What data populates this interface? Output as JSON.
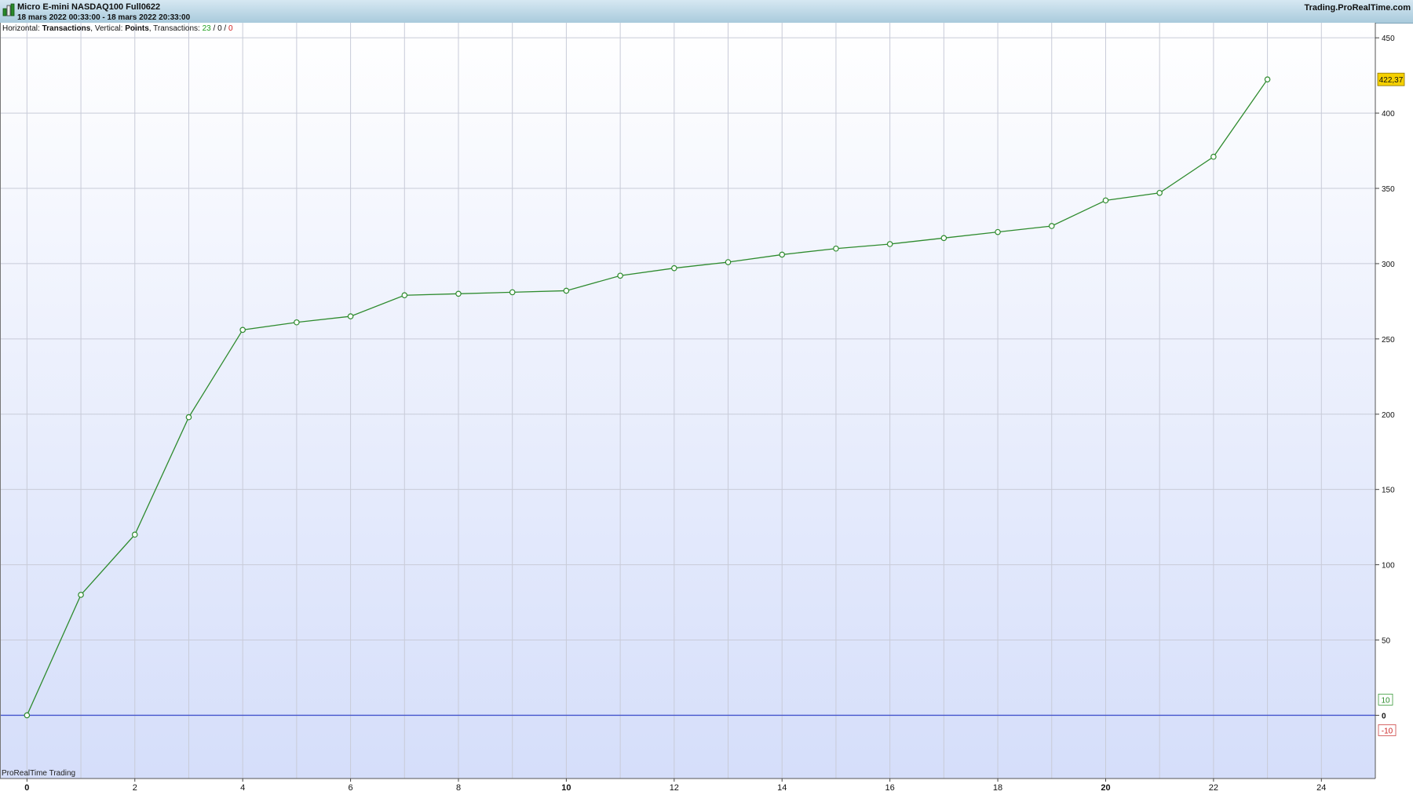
{
  "header": {
    "title": "Micro E-mini NASDAQ100 Full0622",
    "date_range": "18 mars 2022 00:33:00 - 18 mars 2022 20:33:00",
    "site": "Trading.ProRealTime.com"
  },
  "info": {
    "h_label": "Horizontal:",
    "h_value": "Transactions",
    "v_label": "Vertical:",
    "v_value": "Points",
    "t_label": "Transactions:",
    "t_total": "23",
    "t_zero": "0",
    "t_neg": "0"
  },
  "watermark": "ProRealTime Trading",
  "colors": {
    "line": "#2e8b2e",
    "zero_line": "#4455cc",
    "badge_bg": "#f5d000",
    "grid": "#c8cbd8"
  },
  "chart_data": {
    "type": "line",
    "x": [
      0,
      1,
      2,
      3,
      4,
      5,
      6,
      7,
      8,
      9,
      10,
      11,
      12,
      13,
      14,
      15,
      16,
      17,
      18,
      19,
      20,
      21,
      22,
      23
    ],
    "series": [
      {
        "values": [
          0,
          80,
          120,
          198,
          256,
          261,
          265,
          279,
          280,
          281,
          282,
          292,
          297,
          301,
          306,
          310,
          313,
          317,
          321,
          325,
          342,
          347,
          371,
          422.37
        ]
      }
    ],
    "xlim": [
      -0.5,
      25
    ],
    "ylim": [
      -42,
      460
    ],
    "xticks": [
      0,
      2,
      4,
      6,
      8,
      10,
      12,
      14,
      16,
      18,
      20,
      22,
      24
    ],
    "xtick_labels": [
      "0",
      "2",
      "4",
      "6",
      "8",
      "10",
      "12",
      "14",
      "16",
      "18",
      "20",
      "22",
      "24"
    ],
    "yticks": [
      0,
      50,
      100,
      150,
      200,
      250,
      300,
      350,
      400,
      450
    ],
    "ytick_labels": [
      "0",
      "50",
      "100",
      "150",
      "200",
      "250",
      "300",
      "350",
      "400",
      "450"
    ],
    "last_value_label": "422,37",
    "side_markers": {
      "positive": "10",
      "negative": "-10"
    },
    "grid": true
  }
}
